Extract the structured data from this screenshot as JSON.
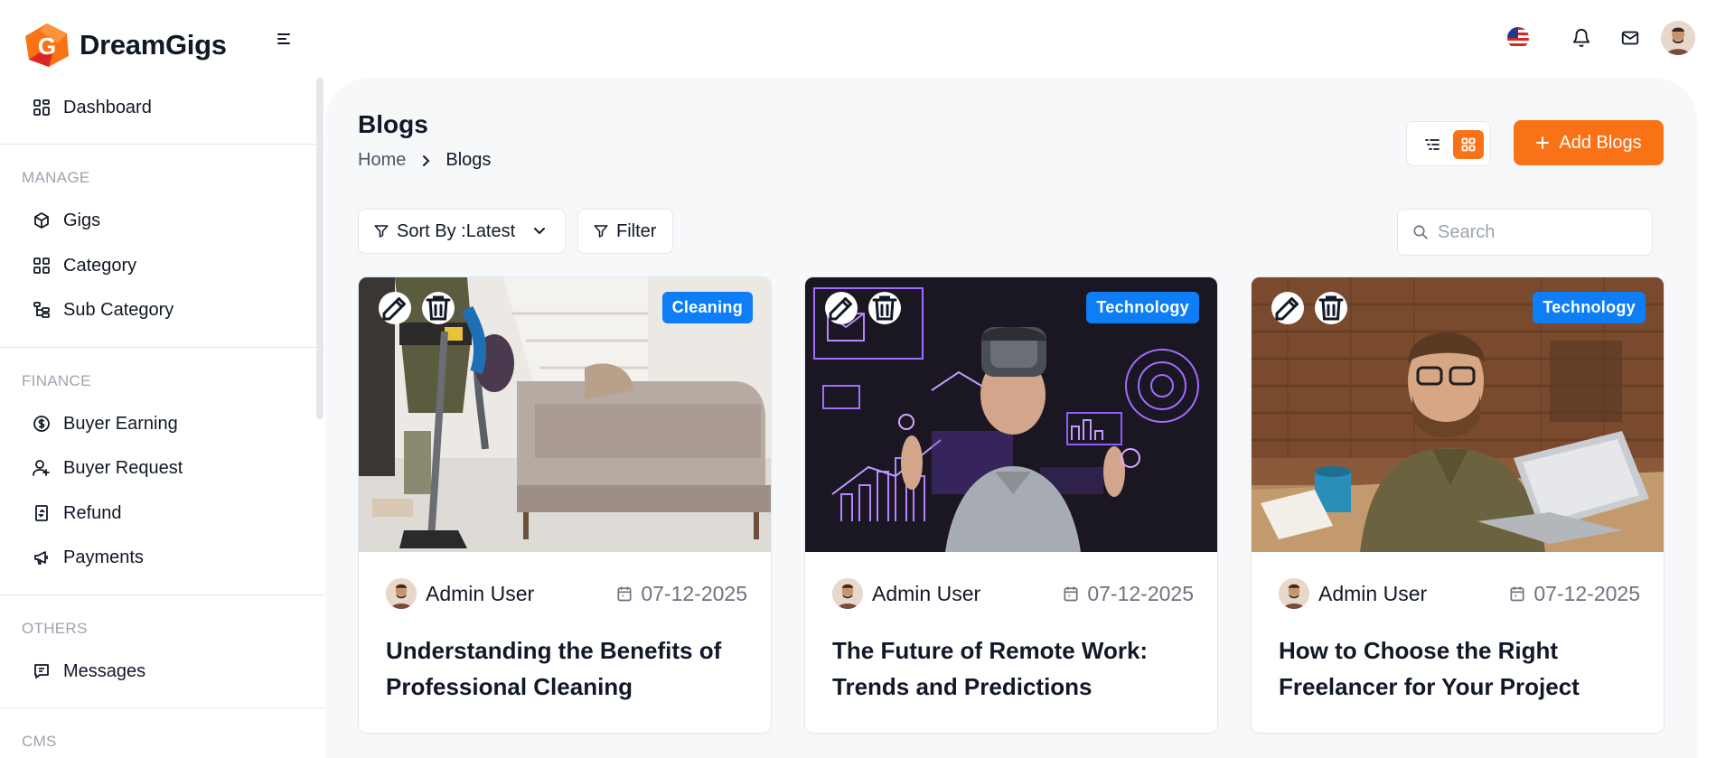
{
  "app": {
    "brand": "DreamGigs"
  },
  "sidebar": {
    "dashboard": "Dashboard",
    "sections": [
      {
        "heading": "MANAGE",
        "items": [
          "Gigs",
          "Category",
          "Sub Category"
        ]
      },
      {
        "heading": "FINANCE",
        "items": [
          "Buyer Earning",
          "Buyer Request",
          "Refund",
          "Payments"
        ]
      },
      {
        "heading": "OTHERS",
        "items": [
          "Messages"
        ]
      },
      {
        "heading": "CMS",
        "items": []
      }
    ]
  },
  "page": {
    "title": "Blogs",
    "breadcrumb": {
      "home": "Home",
      "current": "Blogs"
    },
    "add_button": "Add Blogs",
    "sort_label": "Sort By :Latest",
    "filter_label": "Filter",
    "search_placeholder": "Search"
  },
  "colors": {
    "accent": "#f97316",
    "badge": "#0d7ef5"
  },
  "blogs": [
    {
      "category": "Cleaning",
      "author": "Admin User",
      "date": "07-12-2025",
      "title": "Understanding the Benefits of Professional Cleaning"
    },
    {
      "category": "Technology",
      "author": "Admin User",
      "date": "07-12-2025",
      "title": "The Future of Remote Work: Trends and Predictions"
    },
    {
      "category": "Technology",
      "author": "Admin User",
      "date": "07-12-2025",
      "title": "How to Choose the Right Freelancer for Your Project"
    }
  ]
}
